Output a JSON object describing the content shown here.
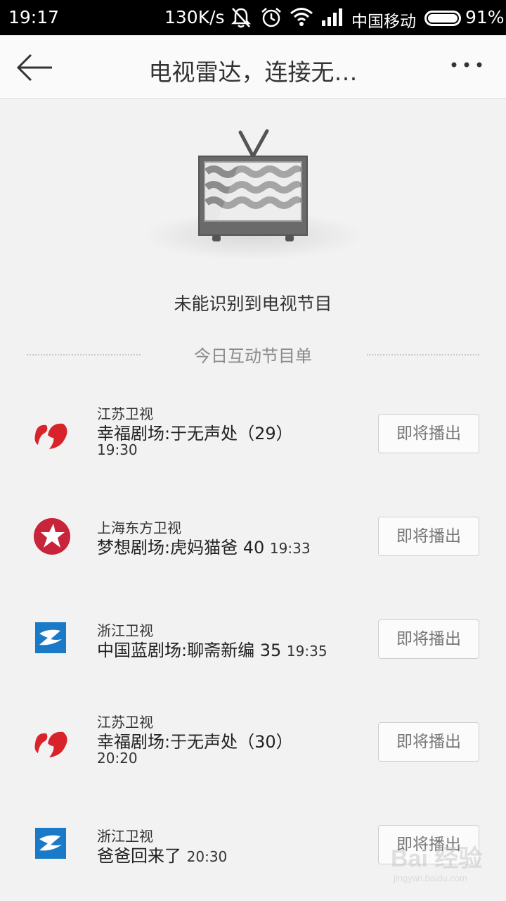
{
  "status_bar": {
    "time": "19:17",
    "speed": "130K/s",
    "carrier": "中国移动",
    "battery": "91%",
    "icons": [
      "mute-icon",
      "alarm-icon",
      "wifi-icon",
      "signal-icon",
      "battery-icon"
    ]
  },
  "app_bar": {
    "title": "电视雷达，连接无…",
    "back_icon": "arrow-left-icon",
    "more_icon": "more-dots-icon"
  },
  "main": {
    "illustration_icon": "tv-icon",
    "status_message": "未能识别到电视节目",
    "section_title": "今日互动节目单"
  },
  "programs": [
    {
      "channel": "江苏卫视",
      "title": "幸福剧场:于无声处（29）",
      "time_inline": "",
      "time": "19:30",
      "logo": "jiangsu-tv-logo",
      "button": "即将播出"
    },
    {
      "channel": "上海东方卫视",
      "title": "梦想剧场:虎妈猫爸 40",
      "time_inline": "19:33",
      "time": "",
      "logo": "dragon-tv-logo",
      "button": "即将播出"
    },
    {
      "channel": "浙江卫视",
      "title": "中国蓝剧场:聊斋新编 35",
      "time_inline": "19:35",
      "time": "",
      "logo": "zhejiang-tv-logo",
      "button": "即将播出"
    },
    {
      "channel": "江苏卫视",
      "title": "幸福剧场:于无声处（30）",
      "time_inline": "",
      "time": "20:20",
      "logo": "jiangsu-tv-logo",
      "button": "即将播出"
    },
    {
      "channel": "浙江卫视",
      "title": "爸爸回来了",
      "time_inline": "20:30",
      "time": "",
      "logo": "zhejiang-tv-logo",
      "button": "即将播出"
    }
  ],
  "watermark": {
    "line1": "Bai 经验",
    "line2": "jingyan.baidu.com"
  },
  "colors": {
    "jiangsu_red": "#d8232a",
    "dragon_red": "#c8243a",
    "zhejiang_blue": "#1a7ac8",
    "background": "#f2f2f2"
  }
}
